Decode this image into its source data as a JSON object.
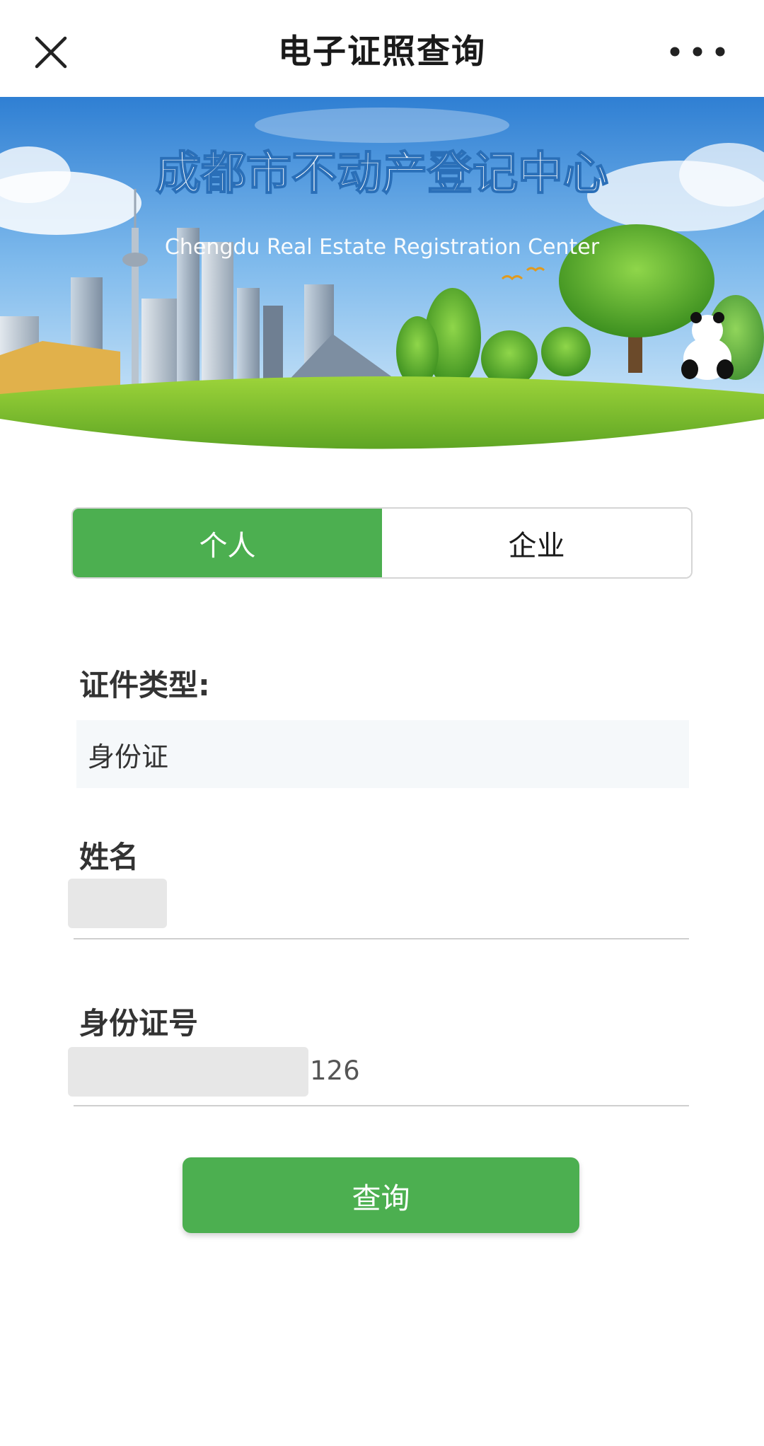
{
  "navbar": {
    "title": "电子证照查询",
    "close_icon": "close-icon",
    "more_icon": "more-horizontal-icon"
  },
  "banner": {
    "title_cn": "成都市不动产登记中心",
    "title_en": "Chengdu Real Estate Registration Center"
  },
  "tabs": [
    {
      "label": "个人",
      "active": true
    },
    {
      "label": "企业",
      "active": false
    }
  ],
  "form": {
    "doc_type_label": "证件类型:",
    "doc_type_value": "身份证",
    "name_label": "姓名",
    "id_label": "身份证号",
    "id_value_visible": "126"
  },
  "submit": {
    "label": "查询"
  },
  "colors": {
    "accent": "#4caf50",
    "title_text": "#1a1a1a"
  }
}
